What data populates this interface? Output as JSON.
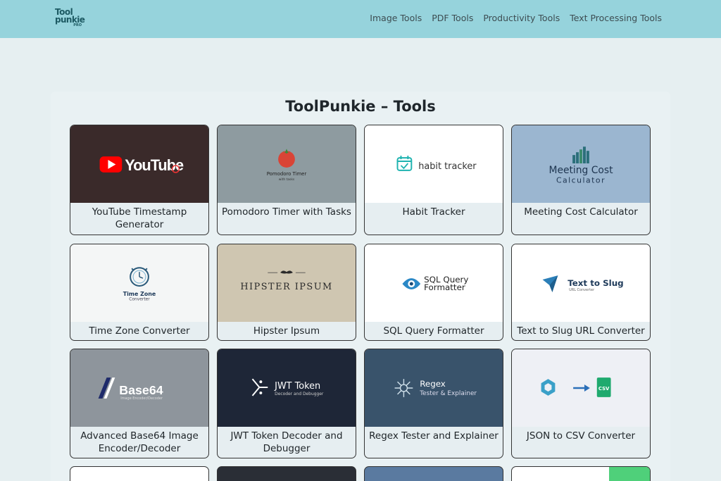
{
  "header": {
    "logo": {
      "line1": "Tool",
      "line2": "punkie",
      "line3": "PRO"
    },
    "nav": [
      "Image Tools",
      "PDF Tools",
      "Productivity Tools",
      "Text Processing Tools"
    ]
  },
  "page": {
    "title": "ToolPunkie – Tools"
  },
  "cards": [
    {
      "label": "YouTube Timestamp Generator",
      "thumb_text": "YouTube",
      "bg": "#3a2a2a"
    },
    {
      "label": "Pomodoro Timer with Tasks",
      "thumb_text": "Pomodoro Timer",
      "thumb_sub": "with tasks",
      "bg": "#8e9ba0"
    },
    {
      "label": "Habit Tracker",
      "thumb_text": "habit tracker",
      "bg": "#ffffff"
    },
    {
      "label": "Meeting Cost Calculator",
      "thumb_text": "Meeting Cost",
      "thumb_sub": "Calculator",
      "bg": "#9bb6d0"
    },
    {
      "label": "Time Zone Converter",
      "thumb_text": "Time Zone",
      "thumb_sub": "Converter",
      "bg": "#f4f6f6"
    },
    {
      "label": "Hipster Ipsum",
      "thumb_text": "HIPSTER IPSUM",
      "bg": "#cfc6b1"
    },
    {
      "label": "SQL Query Formatter",
      "thumb_text": "SQL Query",
      "thumb_sub": "Formatter",
      "bg": "#ffffff"
    },
    {
      "label": "Text to Slug URL Converter",
      "thumb_text": "Text to Slug",
      "thumb_sub": "URL Converter",
      "bg": "#ffffff"
    },
    {
      "label": "Advanced Base64 Image Encoder/Decoder",
      "thumb_text": "Base64",
      "thumb_sub": "Image Encoder/Decoder",
      "bg": "#8e959c"
    },
    {
      "label": "JWT Token Decoder and Debugger",
      "thumb_text": "JWT Token",
      "thumb_sub": "Decoder and Debugger",
      "bg": "#1e2637"
    },
    {
      "label": "Regex Tester and Explainer",
      "thumb_text": "Regex",
      "thumb_sub": "Tester & Explainer",
      "bg": "#39536b"
    },
    {
      "label": "JSON to CSV Converter",
      "thumb_text": "CSV",
      "bg": "#eef0f5"
    }
  ]
}
